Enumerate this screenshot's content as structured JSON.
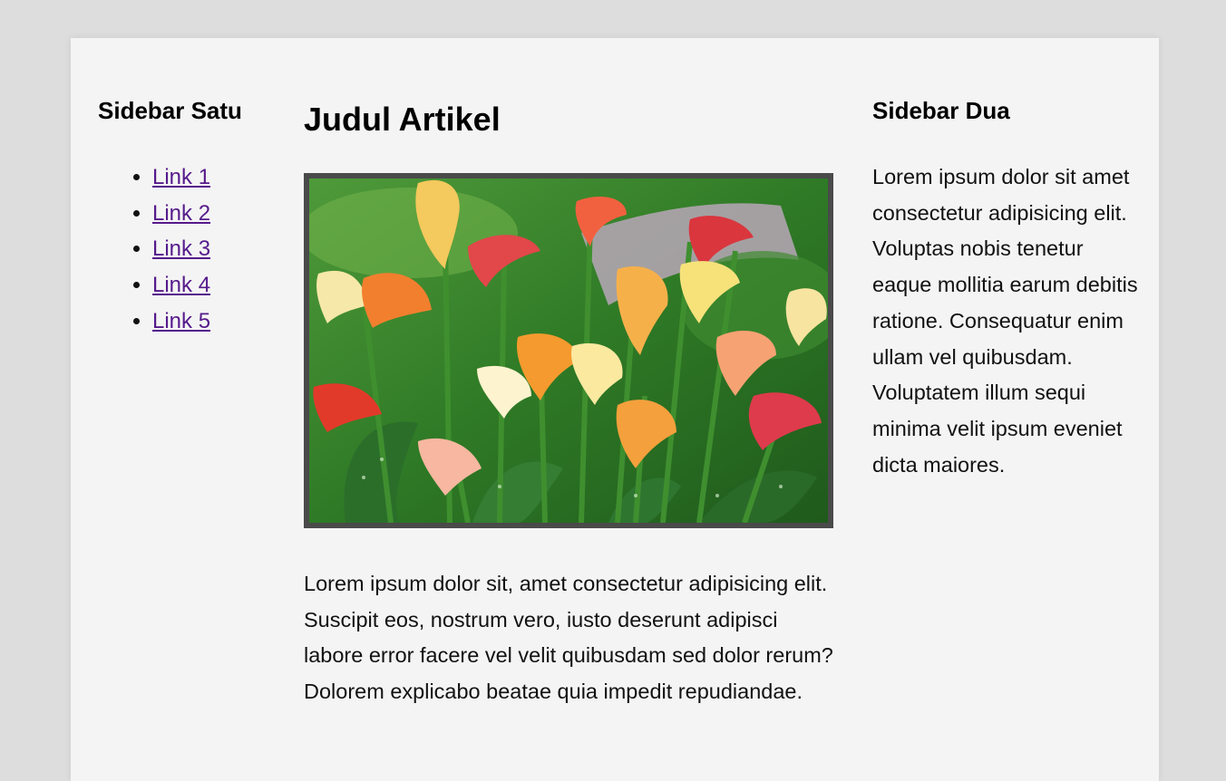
{
  "sidebar_left": {
    "title": "Sidebar Satu",
    "links": [
      "Link 1",
      "Link 2",
      "Link 3",
      "Link 4",
      "Link 5"
    ]
  },
  "main": {
    "title": "Judul Artikel",
    "body": "Lorem ipsum dolor sit, amet consectetur adipisicing elit. Suscipit eos, nostrum vero, iusto deserunt adipisci labore error facere vel velit quibusdam sed dolor rerum? Dolorem explicabo beatae quia impedit repudiandae."
  },
  "sidebar_right": {
    "title": "Sidebar Dua",
    "body": "Lorem ipsum dolor sit amet consectetur adipisicing elit. Voluptas nobis tenetur eaque mollitia earum debitis ratione. Consequatur enim ullam vel quibusdam. Voluptatem illum sequi minima velit ipsum eveniet dicta maiores."
  },
  "colors": {
    "page_background": "#dddddd",
    "container_background": "#f4f4f4",
    "link_visited": "#551a8b",
    "image_border": "#4a4a4a"
  }
}
